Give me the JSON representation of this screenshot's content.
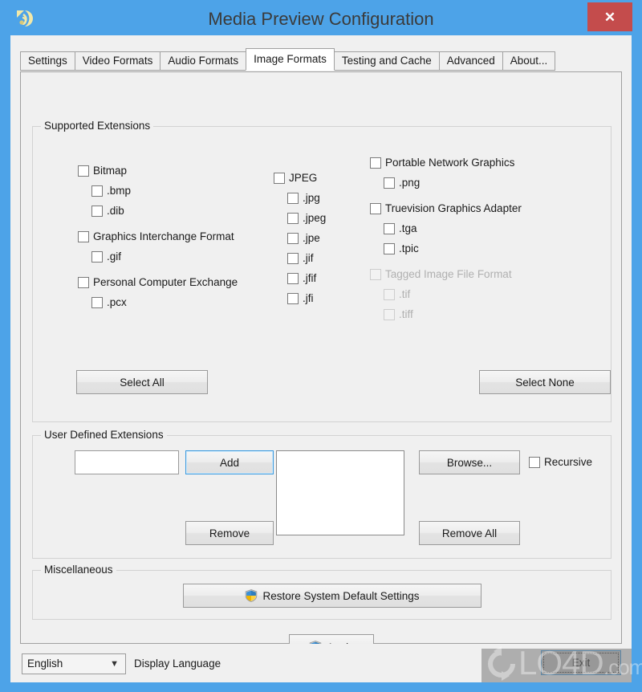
{
  "window": {
    "title": "Media Preview Configuration",
    "app_icon": "media-preview-icon",
    "close_label": "✕",
    "titlebar_color": "#4da3e8",
    "close_button_color": "#c44c4c",
    "client_background": "#f0f0f0"
  },
  "tabs": [
    {
      "label": "Settings",
      "selected": false
    },
    {
      "label": "Video Formats",
      "selected": false
    },
    {
      "label": "Audio Formats",
      "selected": false
    },
    {
      "label": "Image Formats",
      "selected": true
    },
    {
      "label": "Testing and Cache",
      "selected": false
    },
    {
      "label": "Advanced",
      "selected": false
    },
    {
      "label": "About...",
      "selected": false
    }
  ],
  "supported_extensions": {
    "group_label": "Supported Extensions",
    "column1": [
      {
        "label": "Bitmap",
        "checked": false,
        "child": false,
        "disabled": false
      },
      {
        "label": ".bmp",
        "checked": false,
        "child": true,
        "disabled": false
      },
      {
        "label": ".dib",
        "checked": false,
        "child": true,
        "disabled": false
      },
      {
        "label": "Graphics Interchange Format",
        "checked": false,
        "child": false,
        "disabled": false
      },
      {
        "label": ".gif",
        "checked": false,
        "child": true,
        "disabled": false
      },
      {
        "label": "Personal Computer Exchange",
        "checked": false,
        "child": false,
        "disabled": false
      },
      {
        "label": ".pcx",
        "checked": false,
        "child": true,
        "disabled": false
      }
    ],
    "column2": [
      {
        "label": "JPEG",
        "checked": false,
        "child": false,
        "disabled": false
      },
      {
        "label": ".jpg",
        "checked": false,
        "child": true,
        "disabled": false
      },
      {
        "label": ".jpeg",
        "checked": false,
        "child": true,
        "disabled": false
      },
      {
        "label": ".jpe",
        "checked": false,
        "child": true,
        "disabled": false
      },
      {
        "label": ".jif",
        "checked": false,
        "child": true,
        "disabled": false
      },
      {
        "label": ".jfif",
        "checked": false,
        "child": true,
        "disabled": false
      },
      {
        "label": ".jfi",
        "checked": false,
        "child": true,
        "disabled": false
      }
    ],
    "column3": [
      {
        "label": "Portable Network Graphics",
        "checked": false,
        "child": false,
        "disabled": false
      },
      {
        "label": ".png",
        "checked": false,
        "child": true,
        "disabled": false
      },
      {
        "label": "Truevision Graphics Adapter",
        "checked": false,
        "child": false,
        "disabled": false
      },
      {
        "label": ".tga",
        "checked": false,
        "child": true,
        "disabled": false
      },
      {
        "label": ".tpic",
        "checked": false,
        "child": true,
        "disabled": false
      },
      {
        "label": "Tagged Image File Format",
        "checked": false,
        "child": false,
        "disabled": true
      },
      {
        "label": ".tif",
        "checked": false,
        "child": true,
        "disabled": true
      },
      {
        "label": ".tiff",
        "checked": false,
        "child": true,
        "disabled": true
      }
    ],
    "select_all_label": "Select All",
    "select_none_label": "Select None"
  },
  "user_defined": {
    "group_label": "User Defined Extensions",
    "input_value": "",
    "input_placeholder": "",
    "add_label": "Add",
    "remove_label": "Remove",
    "browse_label": "Browse...",
    "remove_all_label": "Remove All",
    "recursive_label": "Recursive",
    "recursive_checked": false,
    "list_items": []
  },
  "miscellaneous": {
    "group_label": "Miscellaneous",
    "restore_label": "Restore System Default Settings",
    "restore_icon": "uac-shield-icon"
  },
  "apply": {
    "label": "Apply",
    "icon": "uac-shield-icon"
  },
  "bottom_bar": {
    "language_value": "English",
    "language_caption": "Display Language",
    "exit_label": "Exit"
  },
  "watermark": {
    "text": "LO4D",
    "suffix": ".com"
  }
}
